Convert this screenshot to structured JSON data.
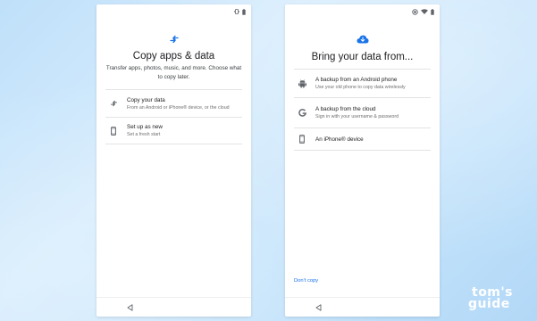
{
  "left_screen": {
    "title": "Copy apps & data",
    "subtitle": "Transfer apps, photos, music, and more. Choose what to copy later.",
    "hero_icon": "transfer-arrows-icon",
    "options": [
      {
        "title": "Copy your data",
        "desc": "From an Android or iPhone® device, or the cloud",
        "icon": "transfer-arrows-icon"
      },
      {
        "title": "Set up as new",
        "desc": "Set a fresh start",
        "icon": "phone-icon"
      }
    ]
  },
  "right_screen": {
    "title": "Bring your data from...",
    "hero_icon": "cloud-download-icon",
    "options": [
      {
        "title": "A backup from an Android phone",
        "desc": "Use your old phone to copy data wirelessly",
        "icon": "android-icon"
      },
      {
        "title": "A backup from the cloud",
        "desc": "Sign in with your username & password",
        "icon": "google-g-icon"
      },
      {
        "title": "An iPhone® device",
        "desc": "",
        "icon": "phone-icon"
      }
    ],
    "dont_copy": "Don't copy"
  },
  "watermark": {
    "line1": "tom's",
    "line2": "guide"
  },
  "colors": {
    "accent": "#1a73e8",
    "background": "#c9e6fb",
    "divider": "#e3e3e3"
  }
}
